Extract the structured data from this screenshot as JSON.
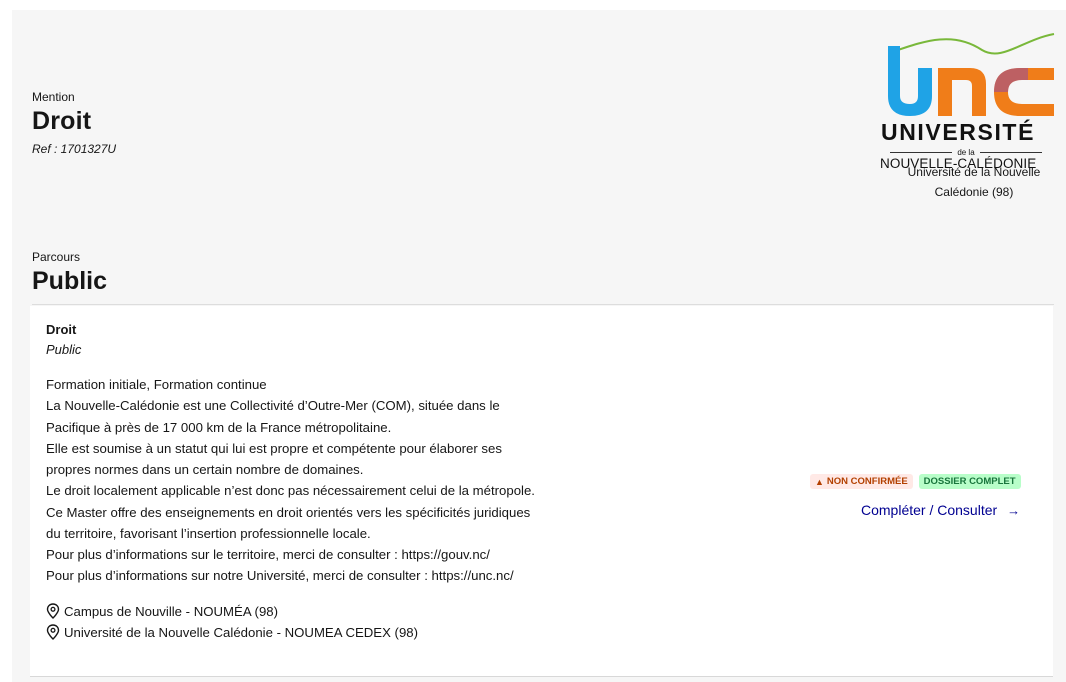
{
  "mention": {
    "label": "Mention",
    "title": "Droit",
    "ref": "Ref : 1701327U"
  },
  "university": {
    "logo_word": "UNIVERSITÉ",
    "logo_dela": "de la",
    "logo_region": "NOUVELLE-CALÉDONIE",
    "name": "Université de la Nouvelle Calédonie (98)",
    "logo_colors": {
      "blue": "#1fa3e6",
      "orange": "#f07d19",
      "purple": "#7e3fbf",
      "green": "#79b83a"
    }
  },
  "parcours": {
    "label": "Parcours",
    "title": "Public"
  },
  "card": {
    "title": "Droit",
    "subtitle": "Public",
    "description_lines": [
      "Formation initiale, Formation continue",
      "La Nouvelle-Calédonie est une Collectivité d’Outre-Mer (COM), située dans le",
      "Pacifique à près de 17 000 km de la France métropolitaine.",
      "Elle est soumise à un statut qui lui est propre et compétente pour élaborer ses",
      "propres normes dans un certain nombre de domaines.",
      "Le droit localement applicable n’est donc pas nécessairement celui de la métropole.",
      "Ce Master offre des enseignements en droit orientés vers les spécificités juridiques",
      "du territoire, favorisant l’insertion professionnelle locale.",
      "Pour plus d’informations sur le territoire, merci de consulter : https://gouv.nc/",
      "Pour plus d’informations sur notre Université, merci de consulter : https://unc.nc/"
    ],
    "locations": [
      "Campus de Nouville - NOUMÉA (98)",
      "Université de la Nouvelle Calédonie - NOUMEA CEDEX (98)"
    ],
    "badges": {
      "warning": "NON CONFIRMÉE",
      "warning_icon": "warning-triangle-icon",
      "success": "DOSSIER COMPLET"
    },
    "action": {
      "label": "Compléter / Consulter",
      "icon": "arrow-right-icon"
    }
  }
}
